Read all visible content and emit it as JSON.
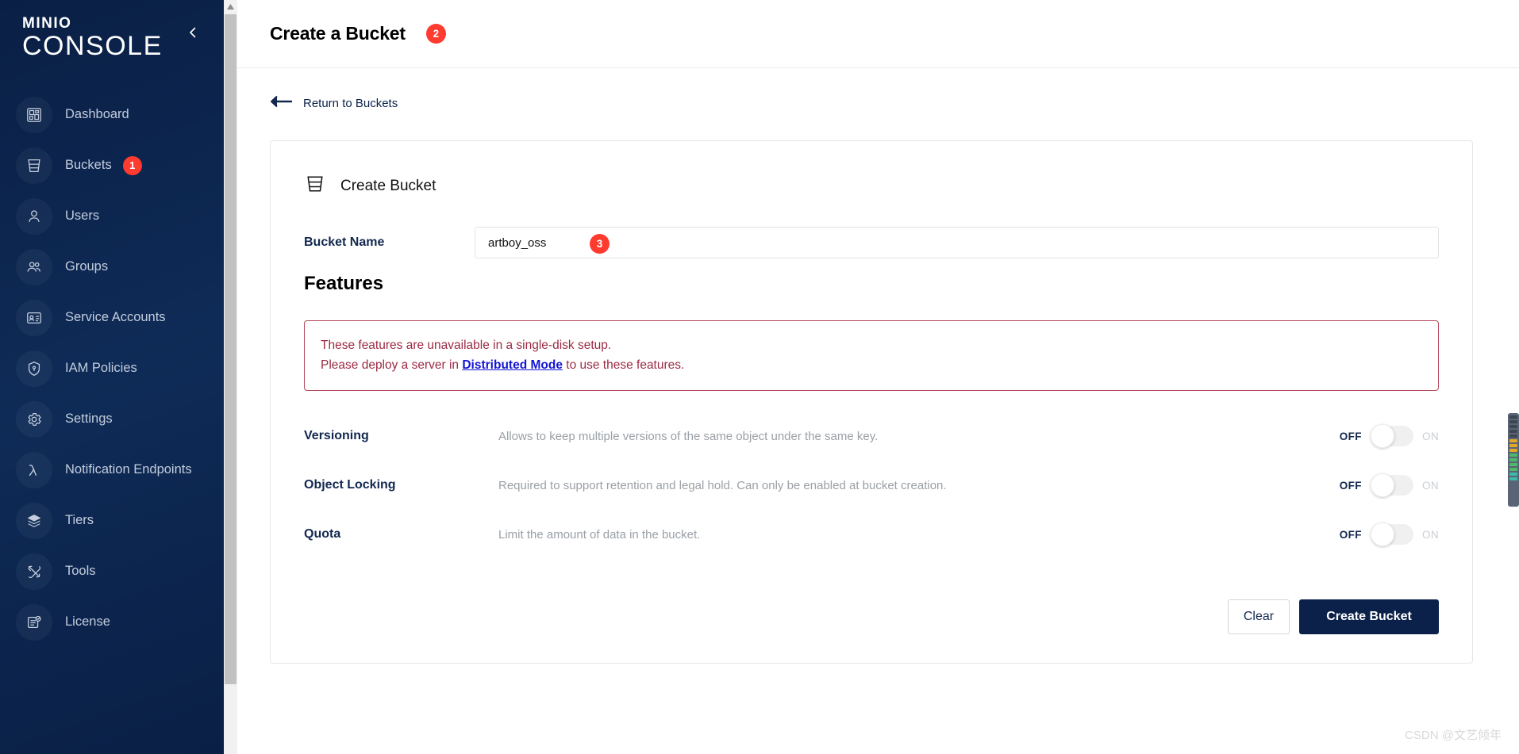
{
  "colors": {
    "sidebar_bg": "#0b2149",
    "accent_navy": "#12284f",
    "badge_red": "#ff3b30",
    "warn_red": "#9c2a43",
    "warn_border": "#b5485d",
    "link_blue": "#1414d6",
    "muted_gray": "#9aa0a6"
  },
  "sidebar": {
    "logo_top": "MINIO",
    "logo_bottom": "CONSOLE",
    "collapse_icon": "chevron-left-icon",
    "items": [
      {
        "label": "Dashboard",
        "icon": "dashboard-icon",
        "badge": null
      },
      {
        "label": "Buckets",
        "icon": "bucket-icon",
        "badge": "1"
      },
      {
        "label": "Users",
        "icon": "user-icon",
        "badge": null
      },
      {
        "label": "Groups",
        "icon": "groups-icon",
        "badge": null
      },
      {
        "label": "Service Accounts",
        "icon": "id-card-icon",
        "badge": null
      },
      {
        "label": "IAM Policies",
        "icon": "shield-icon",
        "badge": null
      },
      {
        "label": "Settings",
        "icon": "gear-icon",
        "badge": null
      },
      {
        "label": "Notification Endpoints",
        "icon": "lambda-icon",
        "badge": null
      },
      {
        "label": "Tiers",
        "icon": "layers-icon",
        "badge": null
      },
      {
        "label": "Tools",
        "icon": "tools-icon",
        "badge": null
      },
      {
        "label": "License",
        "icon": "license-icon",
        "badge": null
      }
    ]
  },
  "header": {
    "title": "Create a Bucket",
    "step_badge": "2"
  },
  "breadcrumb": {
    "back_icon": "arrow-left-icon",
    "label": "Return to Buckets"
  },
  "card": {
    "icon": "bucket-icon",
    "title": "Create Bucket",
    "bucket_name_label": "Bucket Name",
    "bucket_name_value": "artboy_oss",
    "bucket_name_placeholder": "",
    "bucket_name_step_badge": "3",
    "features_heading": "Features",
    "warning": {
      "line1": "These features are unavailable in a single-disk setup.",
      "line2_before": "Please deploy a server in ",
      "line2_link": "Distributed Mode",
      "line2_after": " to use these features."
    },
    "features": [
      {
        "name": "Versioning",
        "description": "Allows to keep multiple versions of the same object under the same key.",
        "off_label": "OFF",
        "on_label": "ON",
        "state": "off"
      },
      {
        "name": "Object Locking",
        "description": "Required to support retention and legal hold. Can only be enabled at bucket creation.",
        "off_label": "OFF",
        "on_label": "ON",
        "state": "off"
      },
      {
        "name": "Quota",
        "description": "Limit the amount of data in the bucket.",
        "off_label": "OFF",
        "on_label": "ON",
        "state": "off"
      }
    ],
    "clear_button": "Clear",
    "create_button": "Create Bucket"
  },
  "watermark": "CSDN @文艺倾年"
}
